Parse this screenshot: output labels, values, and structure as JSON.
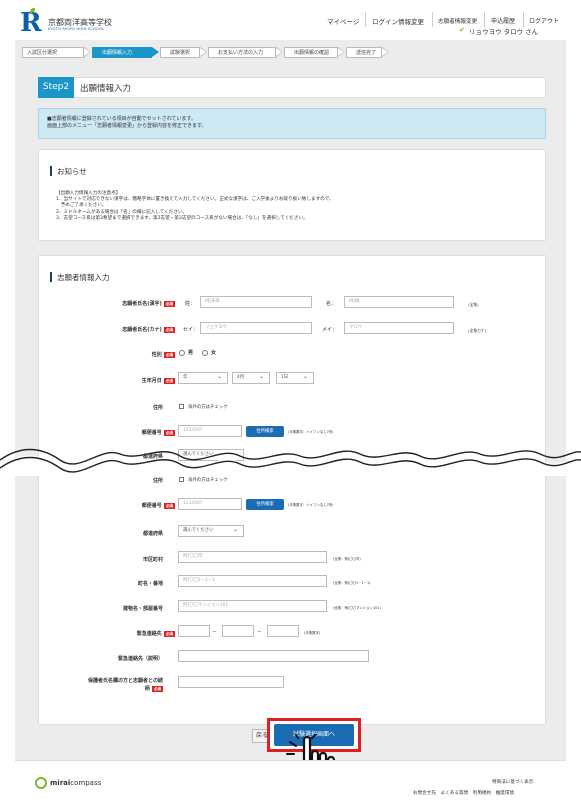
{
  "header": {
    "logo_mark": "R",
    "school_name": "京都両洋高等学校",
    "school_sub": "KYOTO RYOYO HIGH SCHOOL",
    "nav": [
      "マイページ",
      "ログイン情報変更",
      "志願者情報変更",
      "申込履歴",
      "ログアウト"
    ],
    "user": "リョウヨウ タロウ さん"
  },
  "steps": [
    "入試区分選択",
    "出願情報入力",
    "試験選択",
    "お支払い方法の入力",
    "出願情報の確認",
    "送信完了"
  ],
  "title": {
    "step": "Step2",
    "text": "出願情報入力"
  },
  "info": {
    "line1": "■志願者情報に登録されている項目が自動でセットされています。",
    "line2": "画面上部のメニュー「志願者情報変更」から登録内容を修正できます。"
  },
  "notice": {
    "heading": "お知らせ",
    "lines": [
      "【出願入力情報入力の注意点】",
      "1．当サイトで対応できない漢字は、簡略字体に置き換えて入力してください。正式な漢字は、ご入学後よりお取り扱い致しますので、",
      "　予めご了承ください。",
      "2．ミドルネームがある場合は「名」の欄に記入してください。",
      "3．志望コース系は第3希望まで選択できます。第2志望・第3志望のコース系がない場合は、「なし」を選択してください。"
    ]
  },
  "form": {
    "heading": "志願者情報入力",
    "required": "必須",
    "name_kanji": {
      "label": "志願者氏名(漢字)",
      "sei_label": "姓：",
      "sei_ph": "例)未来",
      "mei_label": "名：",
      "mei_ph": "例)換",
      "note": "(全角)"
    },
    "name_kana": {
      "label": "志願者氏名(カナ)",
      "sei_label": "セイ：",
      "sei_ph": "リョウヨウ",
      "mei_label": "メイ：",
      "mei_ph": "タロウ",
      "note": "(全角カナ)"
    },
    "gender": {
      "label": "性別",
      "options": [
        "男",
        "女"
      ]
    },
    "birth": {
      "label": "生年月日",
      "year": "年",
      "month": "4月",
      "day": "1日"
    },
    "address1": {
      "label": "住所",
      "check": "海外の方はチェック"
    },
    "postal1": {
      "label": "郵便番号",
      "ph": "1234567",
      "btn": "住所検索",
      "note": "(半角数字：ハイフンなし7桁)"
    },
    "pref1": {
      "label": "都道府県",
      "value": "選んでください"
    },
    "address2": {
      "label": "住所",
      "check": "海外の方はチェック"
    },
    "postal2": {
      "label": "郵便番号",
      "ph": "1234567",
      "btn": "住所検索",
      "note": "(半角数字：ハイフンなし7桁)"
    },
    "pref2": {
      "label": "都道府県",
      "value": "選んでください"
    },
    "city": {
      "label": "市区町村",
      "ph": "例)〇〇市",
      "note": "(全角：例)〇〇市)"
    },
    "town": {
      "label": "町名・番地",
      "ph": "例)〇〇1－1－1",
      "note": "(全角：例)〇〇1－1－1)"
    },
    "building": {
      "label": "建物名・部屋番号",
      "ph": "例)〇〇マンション101",
      "note": "(全角：例)〇〇マンション101)"
    },
    "emergency": {
      "label": "緊急連絡先",
      "dash": "－",
      "note": "(半角数字)"
    },
    "emergency_desc": {
      "label": "緊急連絡先（説明）"
    },
    "guardian": {
      "label1": "保護者氏名欄の方と志願者との続",
      "label2": "柄"
    }
  },
  "buttons": {
    "back": "戻る",
    "next": "試験選択画面へ"
  },
  "footer": {
    "brand_bold": "mirai",
    "brand_rest": "compass",
    "links_top": "特商法に基づく表示",
    "links_bottom": "お問合せ先　よくある質問　利用規約　推奨環境"
  },
  "colors": {
    "accent": "#1c95c9",
    "required": "#d22222",
    "highlight": "#e02020"
  }
}
